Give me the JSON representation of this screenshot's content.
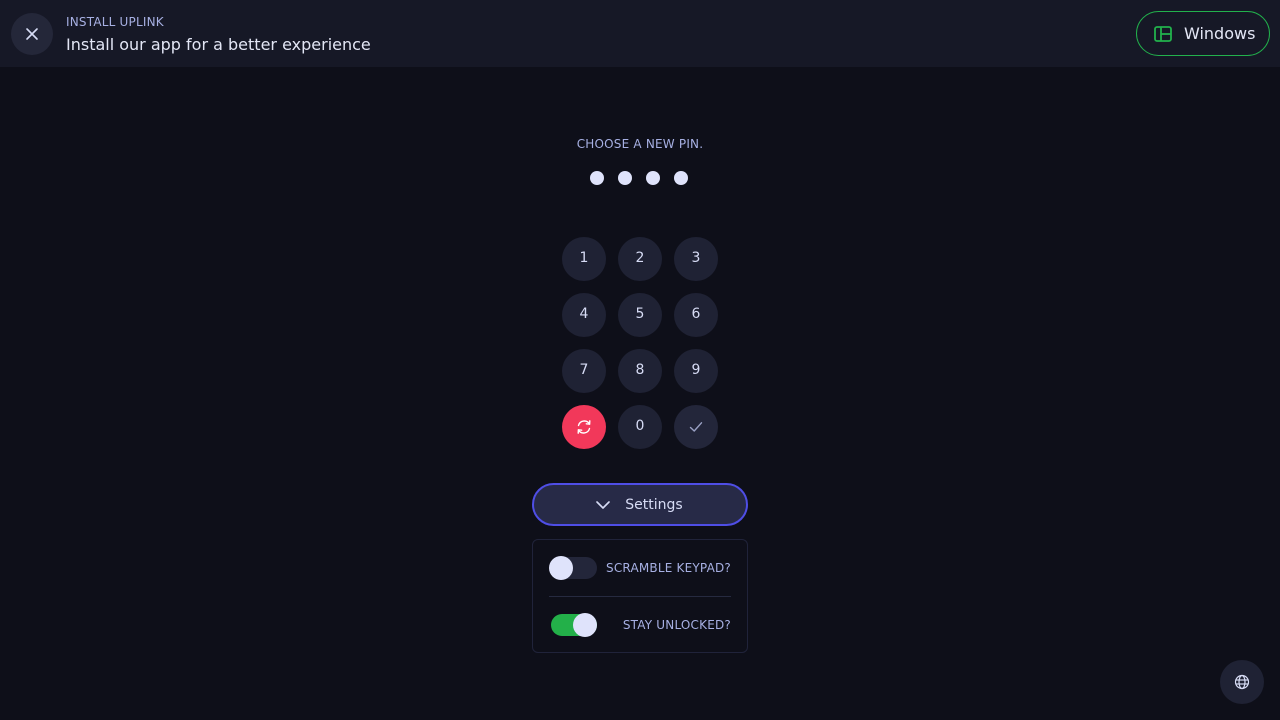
{
  "banner": {
    "eyebrow": "INSTALL UPLINK",
    "title": "Install our app for a better experience",
    "close_icon": "close-icon",
    "platform_label": "Windows",
    "platform_icon": "windows-icon",
    "accent": "#22b14c"
  },
  "pin": {
    "prompt": "CHOOSE A NEW PIN.",
    "entered_digits": 4
  },
  "keypad": {
    "keys": [
      "1",
      "2",
      "3",
      "4",
      "5",
      "6",
      "7",
      "8",
      "9"
    ],
    "reset_icon": "refresh-icon",
    "zero": "0",
    "confirm_icon": "check-icon",
    "reset_color": "#f2385a"
  },
  "settings": {
    "toggle_label": "Settings",
    "toggle_icon": "chevron-down-icon",
    "accent": "#4f4ee6",
    "options": [
      {
        "label": "SCRAMBLE KEYPAD?",
        "enabled": false
      },
      {
        "label": "STAY UNLOCKED?",
        "enabled": true
      }
    ]
  },
  "footer": {
    "language_icon": "globe-icon"
  }
}
